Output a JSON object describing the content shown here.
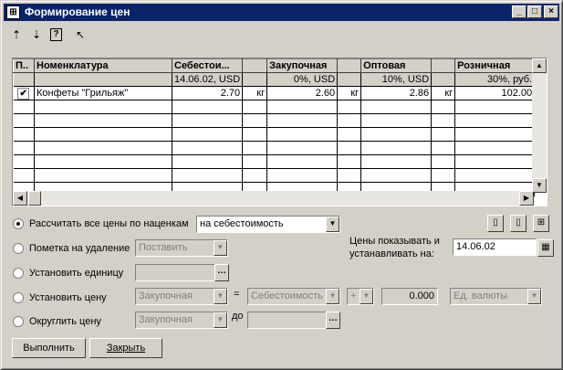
{
  "window": {
    "title": "Формирование цен",
    "app_icon": "grid-icon"
  },
  "titlebar_buttons": {
    "minimize": "_",
    "maximize": "□",
    "close": "×"
  },
  "toolbar": [
    {
      "icon": "arrow-up-icon",
      "glyph": "⇡"
    },
    {
      "icon": "arrow-down-icon",
      "glyph": "⇣"
    },
    {
      "icon": "help-icon",
      "glyph": "?"
    },
    {
      "icon": "cursor-help-icon",
      "glyph": "↖"
    }
  ],
  "grid": {
    "headers": [
      "П..",
      "Номенклатура",
      "Себестои...",
      "",
      "Закупочная",
      "",
      "Оптовая",
      "",
      "Розничная"
    ],
    "subheader": [
      "",
      "",
      "14.06.02, USD",
      "",
      "0%, USD",
      "",
      "10%, USD",
      "",
      "30%, руб."
    ],
    "rows": [
      {
        "checked": "✔",
        "name": "Конфеты \"Грильяж\"",
        "cost": "2.70",
        "unit1": "кг",
        "purchase": "2.60",
        "unit2": "кг",
        "wholesale": "2.86",
        "unit3": "кг",
        "retail": "102.00"
      }
    ]
  },
  "options": {
    "recalc_label": "Рассчитать все цены по наценкам",
    "recalc_value": "на себестоимость",
    "delete_label": "Пометка на удаление",
    "delete_value": "Поставить",
    "unit_label": "Установить единицу",
    "price_label": "Установить цену",
    "price_type": "Закупочная",
    "price_eq": "=",
    "price_base": "Себестоимость",
    "price_op": "+",
    "price_value": "0.000",
    "price_currency": "Ед. валюты",
    "round_label": "Округлить цену",
    "round_type": "Закупочная",
    "round_to": "до",
    "dates_label_1": "Цены показывать и",
    "dates_label_2": "устанавливать на:",
    "date_value": "14.06.02"
  },
  "buttons": {
    "execute": "Выполнить",
    "close": "Закрыть"
  }
}
